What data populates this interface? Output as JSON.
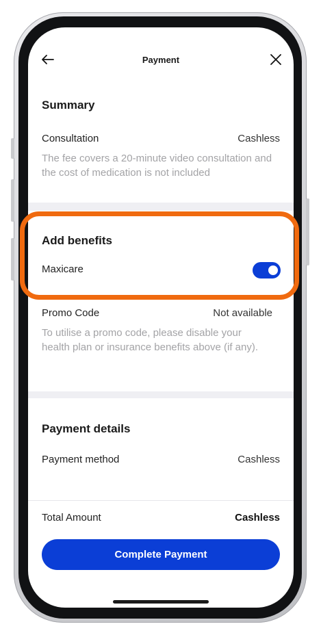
{
  "header": {
    "title": "Payment",
    "back_icon": "arrow-left-icon",
    "close_icon": "close-icon"
  },
  "summary": {
    "title": "Summary",
    "consultation_label": "Consultation",
    "consultation_value": "Cashless",
    "description": "The fee covers a 20-minute video consultation and the cost of medication is not included"
  },
  "benefits": {
    "title": "Add benefits",
    "maxicare_label": "Maxicare",
    "maxicare_enabled": true
  },
  "promo": {
    "label": "Promo Code",
    "value": "Not available",
    "description": "To utilise a promo code, please disable your health plan or insurance benefits above (if any)."
  },
  "payment_details": {
    "title": "Payment details",
    "method_label": "Payment method",
    "method_value": "Cashless"
  },
  "total": {
    "label": "Total Amount",
    "value": "Cashless"
  },
  "actions": {
    "complete_label": "Complete Payment"
  },
  "colors": {
    "primary": "#0b3ed6",
    "highlight": "#f06a0f",
    "muted_text": "#a3a3a6",
    "band": "#efeff3"
  }
}
